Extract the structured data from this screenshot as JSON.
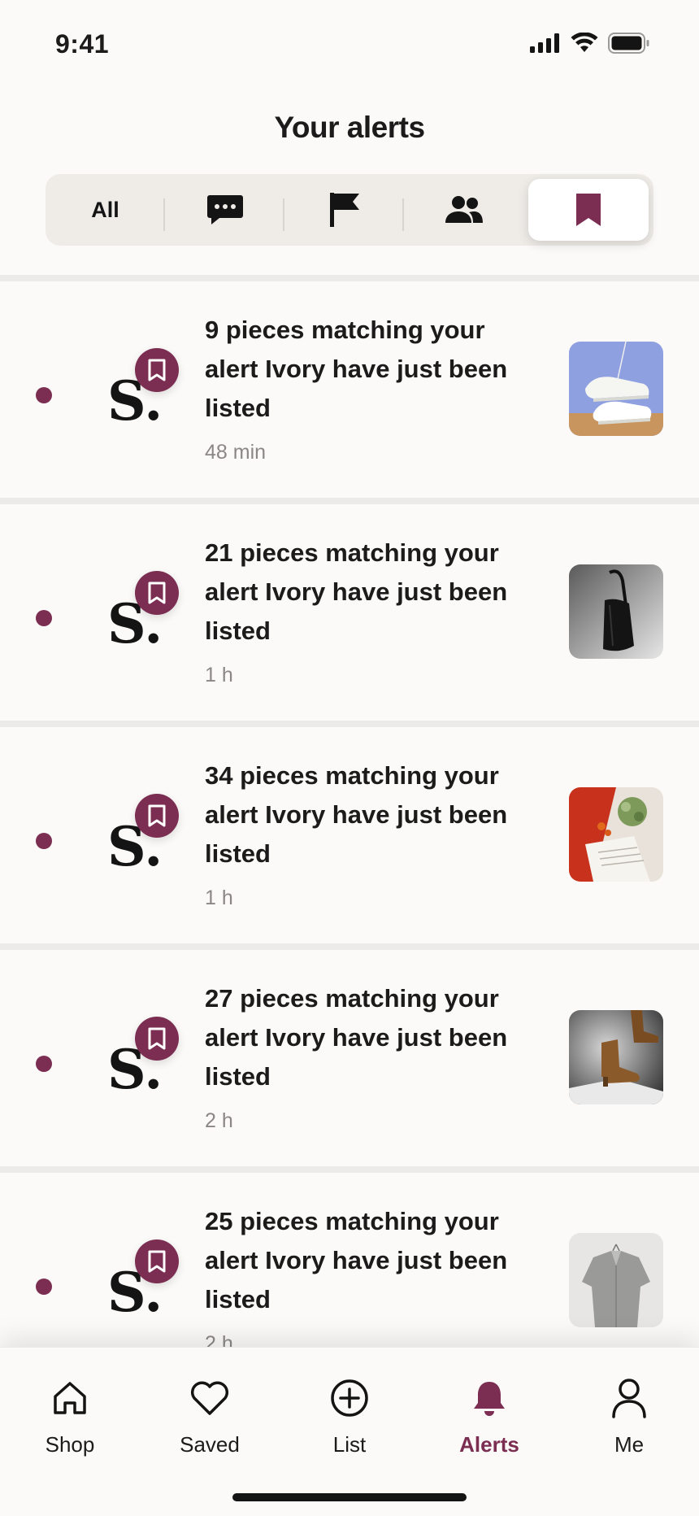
{
  "status_bar": {
    "time": "9:41",
    "icons": [
      "cellular-signal-icon",
      "wifi-icon",
      "battery-icon"
    ]
  },
  "header": {
    "title": "Your alerts"
  },
  "filters": [
    {
      "label": "All",
      "icon": null,
      "selected": false
    },
    {
      "label": "",
      "icon": "message-icon",
      "selected": false
    },
    {
      "label": "",
      "icon": "flag-icon",
      "selected": false
    },
    {
      "label": "",
      "icon": "people-icon",
      "selected": false
    },
    {
      "label": "",
      "icon": "bookmark-icon",
      "selected": true
    }
  ],
  "brand": {
    "logo_text": "S."
  },
  "alerts": [
    {
      "text": "9 pieces matching your alert Ivory have just been listed",
      "time": "48 min",
      "thumb": "sneakers-thumbnail"
    },
    {
      "text": "21 pieces matching your alert Ivory have just been listed",
      "time": "1 h",
      "thumb": "handbag-thumbnail"
    },
    {
      "text": "34 pieces matching your alert Ivory have just been listed",
      "time": "1 h",
      "thumb": "knitwear-thumbnail"
    },
    {
      "text": "27 pieces matching your alert Ivory have just been listed",
      "time": "2 h",
      "thumb": "boots-thumbnail"
    },
    {
      "text": "25 pieces matching your alert Ivory have just been listed",
      "time": "2 h",
      "thumb": "shirt-thumbnail"
    }
  ],
  "tab_bar": [
    {
      "label": "Shop",
      "icon": "home-icon",
      "active": false
    },
    {
      "label": "Saved",
      "icon": "heart-icon",
      "active": false
    },
    {
      "label": "List",
      "icon": "plus-circle-icon",
      "active": false
    },
    {
      "label": "Alerts",
      "icon": "bell-icon",
      "active": true
    },
    {
      "label": "Me",
      "icon": "person-icon",
      "active": false
    }
  ],
  "colors": {
    "accent": "#7b2d52",
    "background": "#fbfaf8",
    "divider": "#ecebe9",
    "text": "#1c1a1a",
    "muted": "#8a8785"
  }
}
